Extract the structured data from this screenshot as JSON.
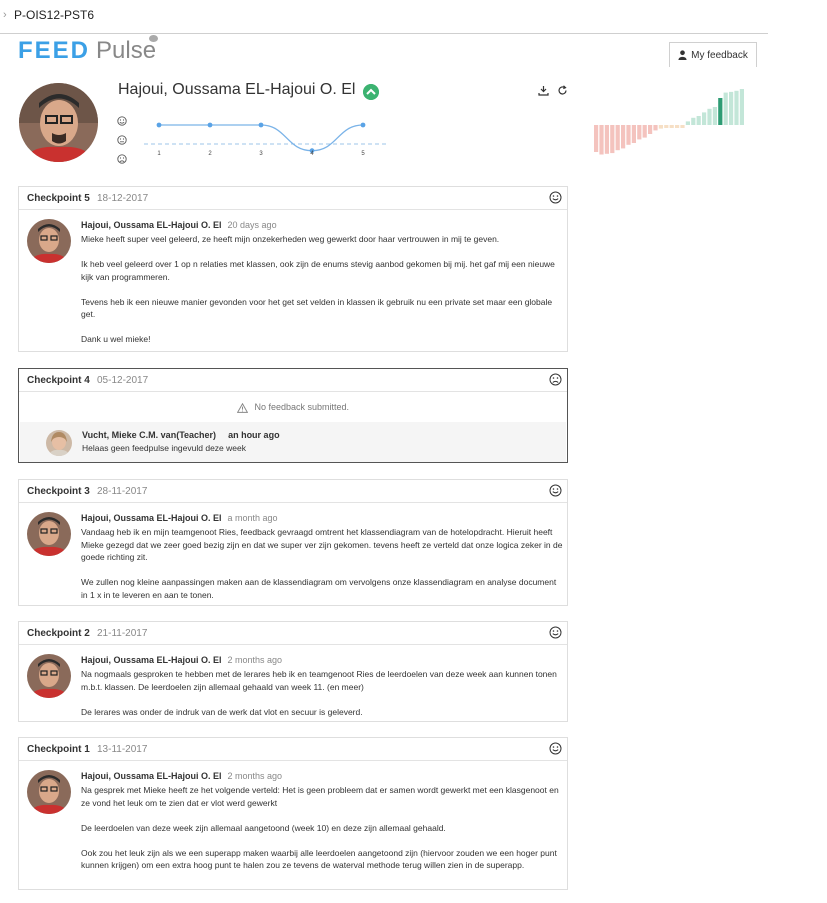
{
  "breadcrumb": {
    "text": "P-OIS12-PST6"
  },
  "logo": {
    "part1": "FEED",
    "part2": "Pulse"
  },
  "header": {
    "my_feedback_label": "My feedback"
  },
  "student": {
    "name": "Hajoui, Oussama EL-Hajoui O. El"
  },
  "mini_chart": {
    "x": [
      "1",
      "2",
      "3",
      "4",
      "5"
    ],
    "levels": [
      "happy",
      "neutral",
      "sad"
    ],
    "values": [
      1,
      1,
      1,
      -0.35,
      1
    ]
  },
  "histogram": {
    "neg_color": "#f4c3be",
    "neu_color": "#f6dfc5",
    "pos_color": "#c3e6d8",
    "current_color": "#2e9c74",
    "values": [
      -0.75,
      -0.82,
      -0.8,
      -0.78,
      -0.7,
      -0.65,
      -0.55,
      -0.5,
      -0.4,
      -0.35,
      -0.25,
      -0.15,
      -0.1,
      -0.08,
      -0.08,
      -0.08,
      -0.05,
      0.1,
      0.2,
      0.25,
      0.35,
      0.45,
      0.5,
      0.75,
      0.9,
      0.92,
      0.95,
      1.0
    ],
    "current_index": 23
  },
  "cards": [
    {
      "checkpoint": "Checkpoint 5",
      "date": "18-12-2017",
      "smiley": "happy",
      "author": "Hajoui, Oussama EL-Hajoui O. El",
      "ago": "20 days ago",
      "paragraphs": [
        "Mieke heeft super veel geleerd, ze heeft mijn onzekerheden weg gewerkt door haar vertrouwen in mij te geven.",
        "Ik heb veel geleerd over 1 op n relaties met klassen, ook zijn de enums stevig aanbod gekomen bij mij. het gaf mij een nieuwe kijk van programmeren.",
        "Tevens heb ik een nieuwe manier gevonden voor het get set velden in klassen ik gebruik nu een private set maar een globale get.",
        "Dank u wel mieke!"
      ]
    },
    {
      "checkpoint": "Checkpoint 4",
      "date": "05-12-2017",
      "smiley": "sad",
      "no_feedback": "No feedback submitted.",
      "teacher": {
        "name": "Vucht, Mieke C.M. van",
        "role": "(Teacher)",
        "ago": "an hour ago",
        "text": "Helaas geen feedpulse ingevuld deze week"
      }
    },
    {
      "checkpoint": "Checkpoint 3",
      "date": "28-11-2017",
      "smiley": "happy",
      "author": "Hajoui, Oussama EL-Hajoui O. El",
      "ago": "a month ago",
      "paragraphs": [
        "Vandaag heb ik en mijn teamgenoot Ries, feedback gevraagd omtrent het klassendiagram van de hotelopdracht. Hieruit heeft Mieke gezegd dat we zeer goed bezig zijn en dat we super ver zijn gekomen. tevens heeft ze verteld dat onze logica zeker in de goede richting zit.",
        "We zullen nog kleine aanpassingen maken aan de klassendiagram om vervolgens onze klassendiagram en analyse document in 1 x in te leveren en aan te tonen."
      ]
    },
    {
      "checkpoint": "Checkpoint 2",
      "date": "21-11-2017",
      "smiley": "happy",
      "author": "Hajoui, Oussama EL-Hajoui O. El",
      "ago": "2 months ago",
      "paragraphs": [
        "Na nogmaals gesproken te hebben met de lerares heb ik en teamgenoot Ries de leerdoelen van deze week aan kunnen tonen m.b.t. klassen. De leerdoelen zijn allemaal gehaald van week 11. (en meer)",
        "De lerares was onder de indruk van de werk dat vlot en secuur is geleverd."
      ]
    },
    {
      "checkpoint": "Checkpoint 1",
      "date": "13-11-2017",
      "smiley": "happy",
      "author": "Hajoui, Oussama EL-Hajoui O. El",
      "ago": "2 months ago",
      "paragraphs": [
        "Na gesprek met Mieke heeft ze het volgende verteld: Het is geen probleem dat er samen wordt gewerkt met een klasgenoot en ze vond het leuk om te zien dat er vlot werd gewerkt",
        "De leerdoelen van deze week zijn allemaal aangetoond (week 10) en deze zijn allemaal gehaald.",
        "Ook zou het leuk zijn als we een superapp maken waarbij alle leerdoelen aangetoond zijn (hiervoor zouden we een hoger punt kunnen krijgen) om een extra hoog punt te halen zou ze tevens de waterval methode terug willen zien in de superapp."
      ]
    }
  ]
}
